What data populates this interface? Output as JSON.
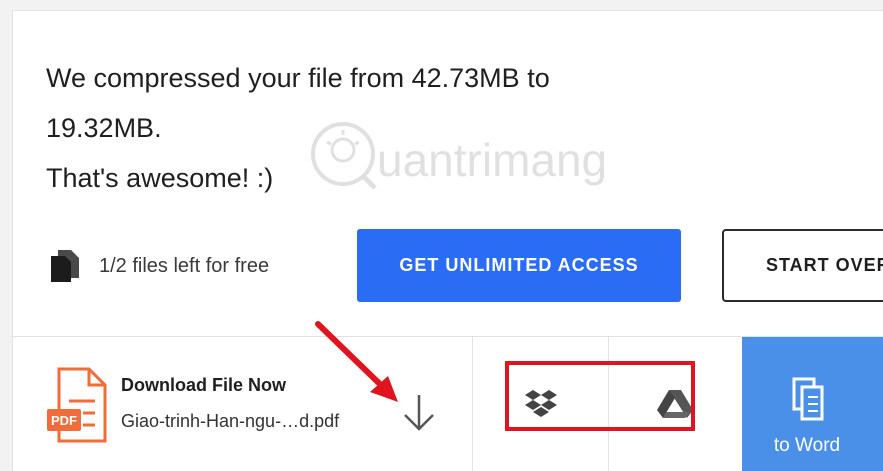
{
  "message": {
    "line1": "We compressed your file from 42.73MB to",
    "line2": "19.32MB.",
    "line3": "That's awesome! :)"
  },
  "files_left": {
    "text": "1/2 files left for free"
  },
  "buttons": {
    "unlimited_label": "GET UNLIMITED ACCESS",
    "start_over_label": "START OVER"
  },
  "download": {
    "title": "Download File Now",
    "filename": "Giao-trinh-Han-ngu-…d.pdf",
    "pdf_badge": "PDF"
  },
  "actions": {
    "to_word_label": "to Word"
  },
  "watermark": {
    "text": "uantrimang"
  },
  "colors": {
    "accent": "#2b6cf5",
    "to_word_bg": "#4a90e8",
    "pdf_orange": "#f26b3a",
    "annotation_red": "#e0141e"
  },
  "icons": {
    "files": "files-stack-icon",
    "pdf": "pdf-file-icon",
    "download": "download-arrow-icon",
    "dropbox": "dropbox-icon",
    "drive": "google-drive-icon",
    "word": "word-document-icon"
  }
}
